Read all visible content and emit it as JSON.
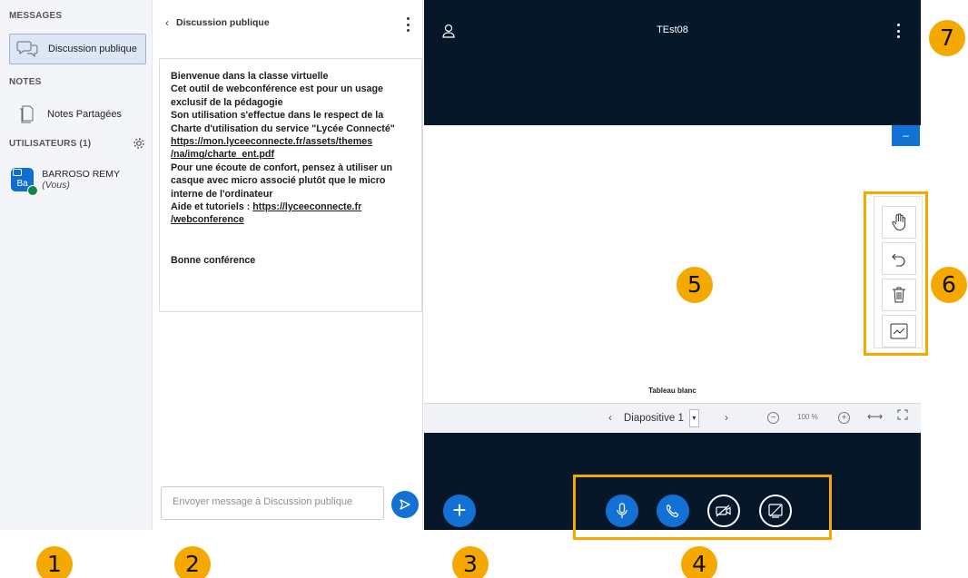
{
  "sidebar": {
    "messages_title": "MESSAGES",
    "public_chat_label": "Discussion publique",
    "notes_title": "NOTES",
    "shared_notes_label": "Notes Partagées",
    "users_title": "UTILISATEURS (1)",
    "user": {
      "initials": "Ba",
      "name": "BARROSO REMY",
      "you": "(Vous)"
    }
  },
  "chat": {
    "header": "Discussion publique",
    "welcome_lines": [
      "Bienvenue dans la classe virtuelle",
      "Cet outil de webconférence est pour un usage",
      "exclusif de la pédagogie",
      "Son utilisation s'effectue dans le respect de la",
      "Charte d'utilisation du service \"Lycée Connecté\""
    ],
    "link_lines": [
      "https://mon.lyceeconnecte.fr/assets/themes",
      "/na/img/charte_ent.pdf"
    ],
    "advice_lines": [
      "Pour une écoute de confort, pensez à utiliser un",
      "casque avec micro associé plutôt que le micro",
      "interne de l'ordinateur"
    ],
    "help_prefix": "Aide et tutoriels : ",
    "help_link_1": "https://lyceeconnecte.fr",
    "help_link_2": "/webconference",
    "closing": "Bonne conférence",
    "input_placeholder": "Envoyer message à Discussion publique"
  },
  "main": {
    "title": "TEst08",
    "slide_caption": "Tableau blanc",
    "slide_select": "Diapositive 1",
    "zoom_level": "100 %"
  },
  "annotations": {
    "n1": "1",
    "n2": "2",
    "n3": "3",
    "n4": "4",
    "n5": "5",
    "n6": "6",
    "n7": "7"
  },
  "colors": {
    "accent": "#1371d6",
    "dark_bg": "#06172a",
    "highlight": "#f5a800"
  },
  "icons": {
    "public_chat": "chat-bubbles-icon",
    "shared_notes": "document-icon",
    "settings": "gear-icon",
    "send": "send-icon",
    "hand": "hand-pan-icon",
    "undo": "undo-icon",
    "trash": "trash-icon",
    "multi_user": "multi-user-whiteboard-icon",
    "mic": "microphone-icon",
    "phone": "phone-icon",
    "camera_off": "camera-off-icon",
    "screenshare_off": "screenshare-off-icon"
  }
}
